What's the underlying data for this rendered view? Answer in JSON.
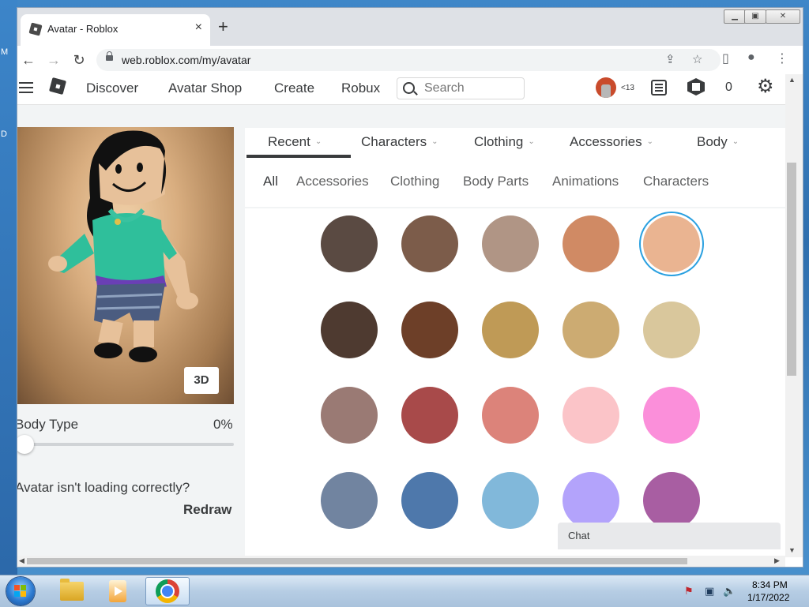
{
  "browser": {
    "tab_title": "Avatar - Roblox",
    "url": "web.roblox.com/my/avatar",
    "new_tab_label": "+",
    "close_tab_label": "×"
  },
  "topnav": {
    "links": [
      "Discover",
      "Avatar Shop",
      "Create",
      "Robux"
    ],
    "search_placeholder": "Search",
    "age_badge": "<13",
    "robux_count": "0"
  },
  "avatar_panel": {
    "view_button": "3D",
    "body_type_label": "Body Type",
    "body_type_value": "0%",
    "body_type_level": 0,
    "loading_message": "Avatar isn't loading correctly?",
    "redraw_label": "Redraw"
  },
  "category_tabs": [
    "Recent",
    "Characters",
    "Clothing",
    "Accessories",
    "Body"
  ],
  "active_category": "Recent",
  "sub_tabs": [
    "All",
    "Accessories",
    "Clothing",
    "Body Parts",
    "Animations",
    "Characters"
  ],
  "active_sub_tab": "All",
  "skin_tones": [
    [
      "#5a4a42",
      "#7c5c4a",
      "#b09585",
      "#d08a64",
      "#eab491"
    ],
    [
      "#4e3a30",
      "#6d3f28",
      "#bf9a56",
      "#ccab72",
      "#d9c79c"
    ],
    [
      "#9a7a74",
      "#a84a4a",
      "#dc837a",
      "#fbc4c8",
      "#fb8fda"
    ],
    [
      "#7184a0",
      "#4e78ab",
      "#81b8da",
      "#b3a3fb",
      "#a85ea2"
    ]
  ],
  "selected_tone": "#eab491",
  "chat_label": "Chat",
  "taskbar": {
    "time": "8:34 PM",
    "date": "1/17/2022"
  },
  "desktop_edge_letters": [
    "M",
    "D"
  ]
}
